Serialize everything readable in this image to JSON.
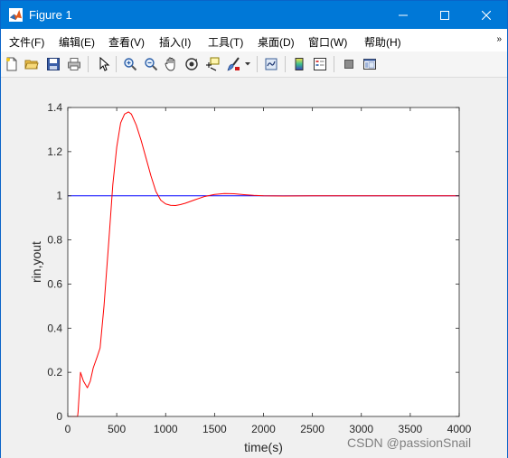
{
  "window": {
    "title": "Figure 1",
    "accent": "#0078d7"
  },
  "menu": {
    "items": [
      "文件(F)",
      "编辑(E)",
      "查看(V)",
      "插入(I)",
      "工具(T)",
      "桌面(D)",
      "窗口(W)",
      "帮助(H)"
    ],
    "overflow_icon": "double-chevron-icon"
  },
  "toolbar": {
    "icons": [
      "new-figure-icon",
      "open-file-icon",
      "save-icon",
      "print-icon",
      "pointer-icon",
      "zoom-in-icon",
      "zoom-out-icon",
      "pan-icon",
      "rotate-3d-icon",
      "data-cursor-icon",
      "brush-icon",
      "link-plot-icon",
      "colorbar-icon",
      "legend-icon",
      "hide-plot-tools-icon",
      "show-plot-tools-icon"
    ]
  },
  "watermark": "CSDN @passionSnail",
  "chart_data": {
    "type": "line",
    "xlabel": "time(s)",
    "ylabel": "rin,yout",
    "xlim": [
      0,
      4000
    ],
    "ylim": [
      0,
      1.4
    ],
    "xticks": [
      "0",
      "500",
      "1000",
      "1500",
      "2000",
      "2500",
      "3000",
      "3500",
      "4000"
    ],
    "yticks": [
      "0",
      "0.2",
      "0.4",
      "0.6",
      "0.8",
      "1",
      "1.2",
      "1.4"
    ],
    "grid": false,
    "series": [
      {
        "color": "#0000ff",
        "x": [
          0,
          4000
        ],
        "y": [
          1,
          1
        ]
      },
      {
        "color": "#ff0000",
        "x": [
          0,
          80,
          100,
          105,
          130,
          160,
          200,
          230,
          260,
          300,
          330,
          370,
          420,
          460,
          500,
          540,
          580,
          620,
          650,
          700,
          750,
          800,
          850,
          900,
          950,
          1000,
          1050,
          1100,
          1150,
          1200,
          1300,
          1400,
          1500,
          1600,
          1700,
          1800,
          1900,
          2000,
          2200,
          2500,
          3000,
          3500,
          4000
        ],
        "y": [
          0,
          0,
          0,
          0.02,
          0.2,
          0.16,
          0.13,
          0.16,
          0.22,
          0.27,
          0.31,
          0.5,
          0.8,
          1.05,
          1.22,
          1.33,
          1.37,
          1.38,
          1.37,
          1.32,
          1.25,
          1.17,
          1.09,
          1.02,
          0.98,
          0.963,
          0.957,
          0.956,
          0.96,
          0.966,
          0.982,
          0.997,
          1.006,
          1.01,
          1.009,
          1.005,
          1.002,
          1.0,
          0.999,
          1.0,
          1.0,
          1.0,
          1.0
        ]
      }
    ]
  }
}
